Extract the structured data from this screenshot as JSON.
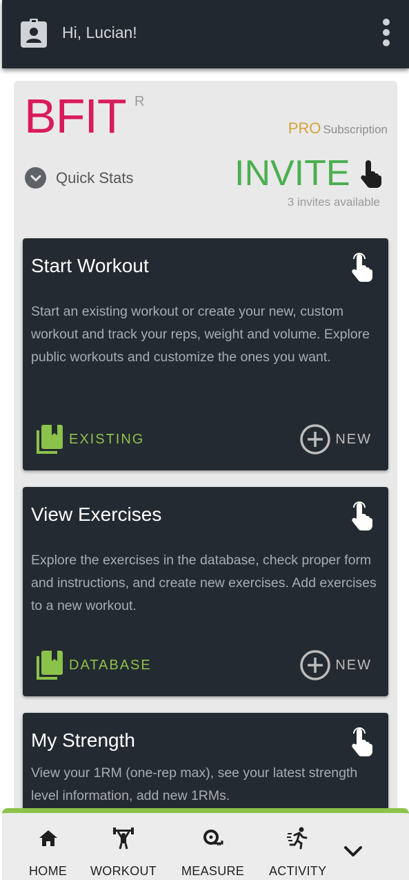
{
  "header": {
    "greeting": "Hi, Lucian!",
    "profile_icon": "account-badge-icon",
    "menu_icon": "more-vert-icon"
  },
  "brand": {
    "logo": "BFIT",
    "logo_mark": "R",
    "plan": "PRO",
    "plan_suffix": "Subscription"
  },
  "quick_stats": {
    "label": "Quick Stats"
  },
  "invite": {
    "label": "INVITE",
    "note": "3 invites available"
  },
  "cards": [
    {
      "title": "Start Workout",
      "description": "Start an existing workout or create your new, custom workout and track your reps, weight and volume. Explore public workouts and customize the ones you want.",
      "left_action": "EXISTING",
      "right_action": "NEW"
    },
    {
      "title": "View Exercises",
      "description": "Explore the exercises in the database, check proper form and instructions, and create new exercises. Add exercises to a new workout.",
      "left_action": "DATABASE",
      "right_action": "NEW"
    },
    {
      "title": "My Strength",
      "description": "View your 1RM (one-rep max), see your latest strength level information, add new 1RMs."
    }
  ],
  "nav": {
    "items": [
      {
        "label": "HOME",
        "icon": "home-icon"
      },
      {
        "label": "WORKOUT",
        "icon": "weightlifter-icon"
      },
      {
        "label": "MEASURE",
        "icon": "tape-measure-icon"
      },
      {
        "label": "ACTIVITY",
        "icon": "running-icon"
      }
    ],
    "more_icon": "chevron-down-icon"
  },
  "colors": {
    "app_bar": "#22282f",
    "brand_pink": "#d81b5c",
    "invite_green": "#4caf50",
    "action_green": "#8bc34a",
    "pro_gold": "#d4a33a",
    "card_bg": "#242a31"
  }
}
